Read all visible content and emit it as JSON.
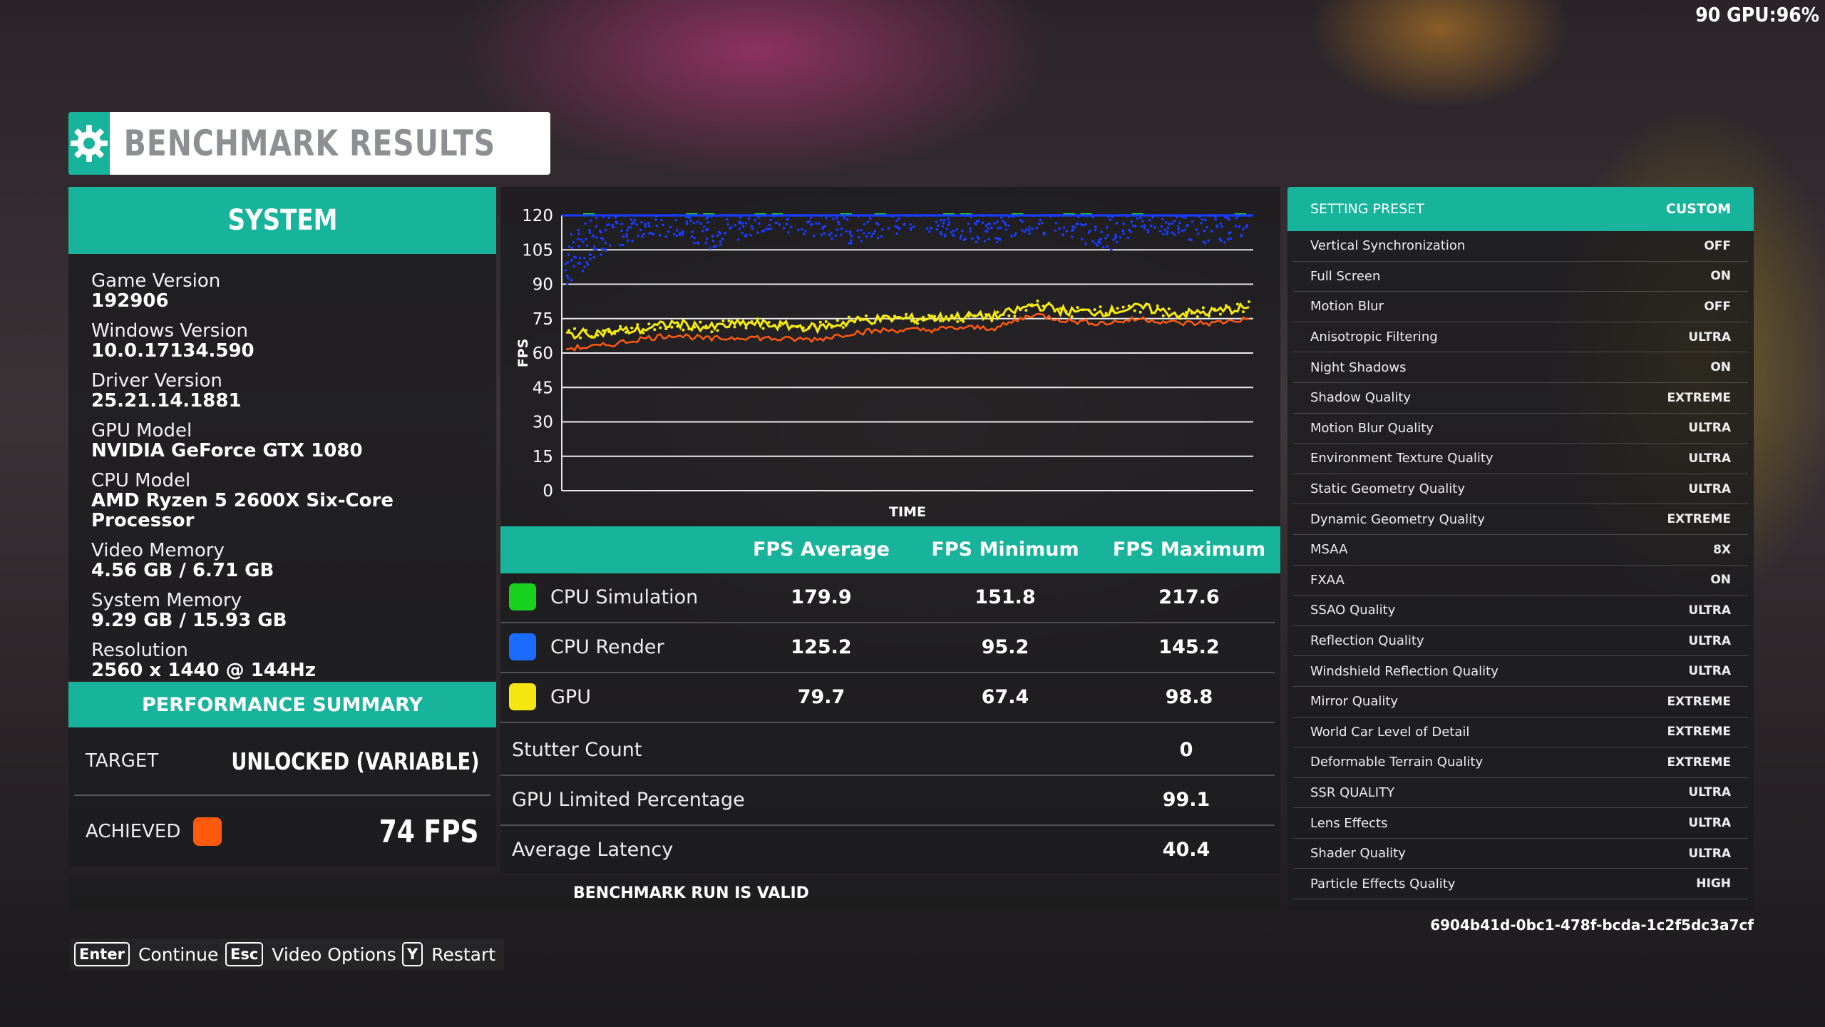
{
  "osd": {
    "text": "90 GPU:96%"
  },
  "header": {
    "title": "BENCHMARK RESULTS",
    "icon": "gear-icon"
  },
  "system": {
    "title": "SYSTEM",
    "items": [
      {
        "label": "Game Version",
        "value": "192906"
      },
      {
        "label": "Windows Version",
        "value": "10.0.17134.590"
      },
      {
        "label": "Driver Version",
        "value": "25.21.14.1881"
      },
      {
        "label": "GPU Model",
        "value": "NVIDIA GeForce GTX 1080"
      },
      {
        "label": "CPU Model",
        "value": "AMD Ryzen 5 2600X Six-Core Processor"
      },
      {
        "label": "Video Memory",
        "value": "4.56 GB / 6.71 GB"
      },
      {
        "label": "System Memory",
        "value": "9.29 GB / 15.93 GB"
      },
      {
        "label": "Resolution",
        "value": "2560 x 1440 @ 144Hz"
      }
    ]
  },
  "performance": {
    "title": "PERFORMANCE SUMMARY",
    "target_label": "TARGET",
    "target_value": "UNLOCKED (VARIABLE)",
    "achieved_label": "ACHIEVED",
    "achieved_value": "74 FPS",
    "achieved_color": "#ff5a0e"
  },
  "chart_data": {
    "type": "line",
    "title": "",
    "xlabel": "TIME",
    "ylabel": "FPS",
    "ylim": [
      0,
      120
    ],
    "yticks": [
      0,
      15,
      30,
      45,
      60,
      75,
      90,
      105,
      120
    ],
    "grid": true,
    "series": [
      {
        "name": "CPU Simulation",
        "color": "#19d21e",
        "values": [
          120,
          120,
          120,
          120,
          120,
          120,
          120,
          120,
          120,
          120,
          120,
          120,
          120,
          120,
          120,
          120,
          120,
          120,
          120,
          120
        ]
      },
      {
        "name": "CPU Render",
        "color": "#1a3cff",
        "values": [
          95,
          110,
          115,
          118,
          112,
          116,
          119,
          117,
          114,
          118,
          119,
          116,
          113,
          118,
          117,
          110,
          119,
          118,
          112,
          119
        ]
      },
      {
        "name": "GPU",
        "color": "#f5ea10",
        "values": [
          68,
          69,
          70,
          73,
          71,
          73,
          72,
          71,
          74,
          75,
          75,
          76,
          76,
          81,
          78,
          78,
          80,
          77,
          78,
          80
        ]
      },
      {
        "name": "Achieved",
        "color": "#ff5a0e",
        "values": [
          62,
          63,
          66,
          68,
          66,
          67,
          66,
          66,
          69,
          70,
          70,
          71,
          71,
          77,
          74,
          73,
          75,
          73,
          73,
          75
        ]
      }
    ]
  },
  "stats": {
    "headers": [
      "FPS Average",
      "FPS Minimum",
      "FPS Maximum"
    ],
    "rows": [
      {
        "name": "CPU Simulation",
        "color": "#19d21e",
        "avg": "179.9",
        "min": "151.8",
        "max": "217.6"
      },
      {
        "name": "CPU Render",
        "color": "#1a6cff",
        "avg": "125.2",
        "min": "95.2",
        "max": "145.2"
      },
      {
        "name": "GPU",
        "color": "#f5e614",
        "avg": "79.7",
        "min": "67.4",
        "max": "98.8"
      }
    ],
    "extra": [
      {
        "name": "Stutter Count",
        "value": "0"
      },
      {
        "name": "GPU Limited Percentage",
        "value": "99.1"
      },
      {
        "name": "Average Latency",
        "value": "40.4"
      }
    ],
    "valid_text": "BENCHMARK RUN IS VALID"
  },
  "settings": {
    "preset_label": "SETTING PRESET",
    "preset_value": "CUSTOM",
    "items": [
      {
        "label": "Vertical Synchronization",
        "value": "OFF"
      },
      {
        "label": "Full Screen",
        "value": "ON"
      },
      {
        "label": "Motion Blur",
        "value": "OFF"
      },
      {
        "label": "Anisotropic Filtering",
        "value": "ULTRA"
      },
      {
        "label": "Night Shadows",
        "value": "ON"
      },
      {
        "label": "Shadow Quality",
        "value": "EXTREME"
      },
      {
        "label": "Motion Blur Quality",
        "value": "ULTRA"
      },
      {
        "label": "Environment Texture Quality",
        "value": "ULTRA"
      },
      {
        "label": "Static Geometry Quality",
        "value": "ULTRA"
      },
      {
        "label": "Dynamic Geometry Quality",
        "value": "EXTREME"
      },
      {
        "label": "MSAA",
        "value": "8X"
      },
      {
        "label": "FXAA",
        "value": "ON"
      },
      {
        "label": "SSAO Quality",
        "value": "ULTRA"
      },
      {
        "label": "Reflection Quality",
        "value": "ULTRA"
      },
      {
        "label": "Windshield Reflection Quality",
        "value": "ULTRA"
      },
      {
        "label": "Mirror Quality",
        "value": "EXTREME"
      },
      {
        "label": "World Car Level of Detail",
        "value": "EXTREME"
      },
      {
        "label": "Deformable Terrain Quality",
        "value": "EXTREME"
      },
      {
        "label": "SSR QUALITY",
        "value": "ULTRA"
      },
      {
        "label": "Lens Effects",
        "value": "ULTRA"
      },
      {
        "label": "Shader Quality",
        "value": "ULTRA"
      },
      {
        "label": "Particle Effects Quality",
        "value": "HIGH"
      }
    ],
    "hash": "6904b41d-0bc1-478f-bcda-1c2f5dc3a7cf"
  },
  "footer": {
    "continue": {
      "key": "Enter",
      "label": "Continue"
    },
    "video": {
      "key": "Esc",
      "label": "Video Options"
    },
    "restart": {
      "key": "Y",
      "label": "Restart"
    }
  }
}
